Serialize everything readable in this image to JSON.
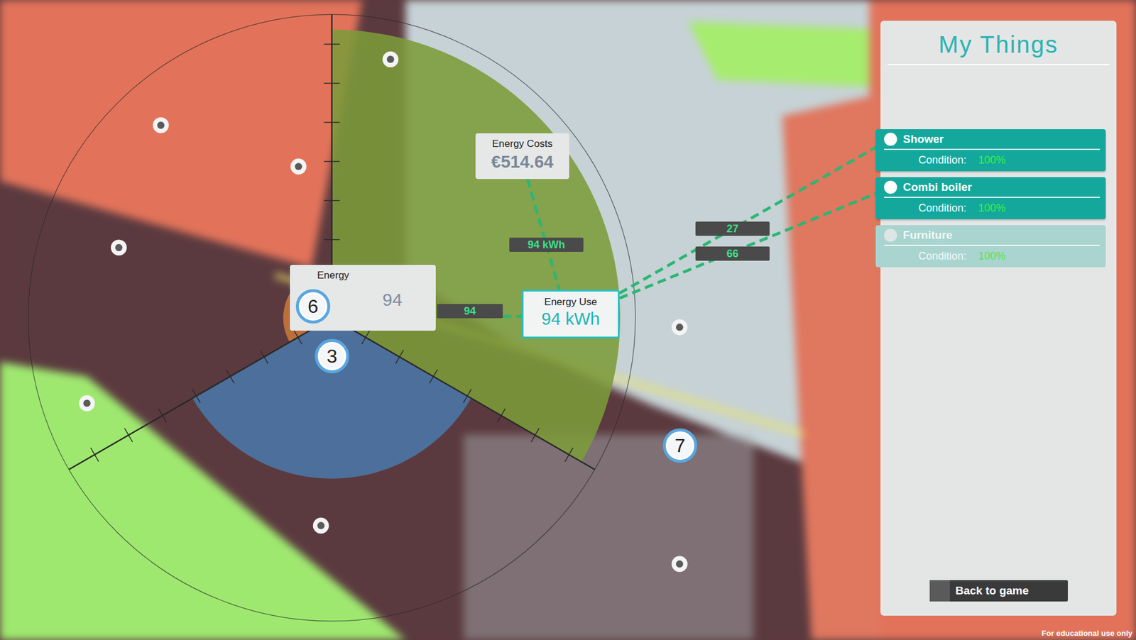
{
  "chart": {
    "sectors": [
      {
        "level": 0.95,
        "color": "#7c9b3a"
      },
      {
        "level": 0.53,
        "color": "#4a77a8"
      },
      {
        "level": 0.16,
        "color": "#c9763a"
      }
    ]
  },
  "badges": [
    {
      "text": "6"
    },
    {
      "text": "3"
    },
    {
      "text": "7"
    }
  ],
  "cards": {
    "energy": {
      "title": "Energy",
      "value": "94"
    },
    "energy_use": {
      "title": "Energy Use",
      "value": "94 kWh"
    },
    "energy_costs": {
      "title": "Energy Costs",
      "value": "€514.64"
    }
  },
  "flows": {
    "energy_to_use": "94",
    "use_to_costs": "94 kWh",
    "shower": "27",
    "combi_boiler": "66"
  },
  "panel": {
    "title": "My Things",
    "items": [
      {
        "name": "Shower",
        "condition_label": "Condition:",
        "condition": "100%",
        "disabled": false
      },
      {
        "name": "Combi boiler",
        "condition_label": "Condition:",
        "condition": "100%",
        "disabled": false
      },
      {
        "name": "Furniture",
        "condition_label": "Condition:",
        "condition": "100%",
        "disabled": true
      }
    ],
    "button": "Back to game"
  },
  "footer": "For educational use only"
}
